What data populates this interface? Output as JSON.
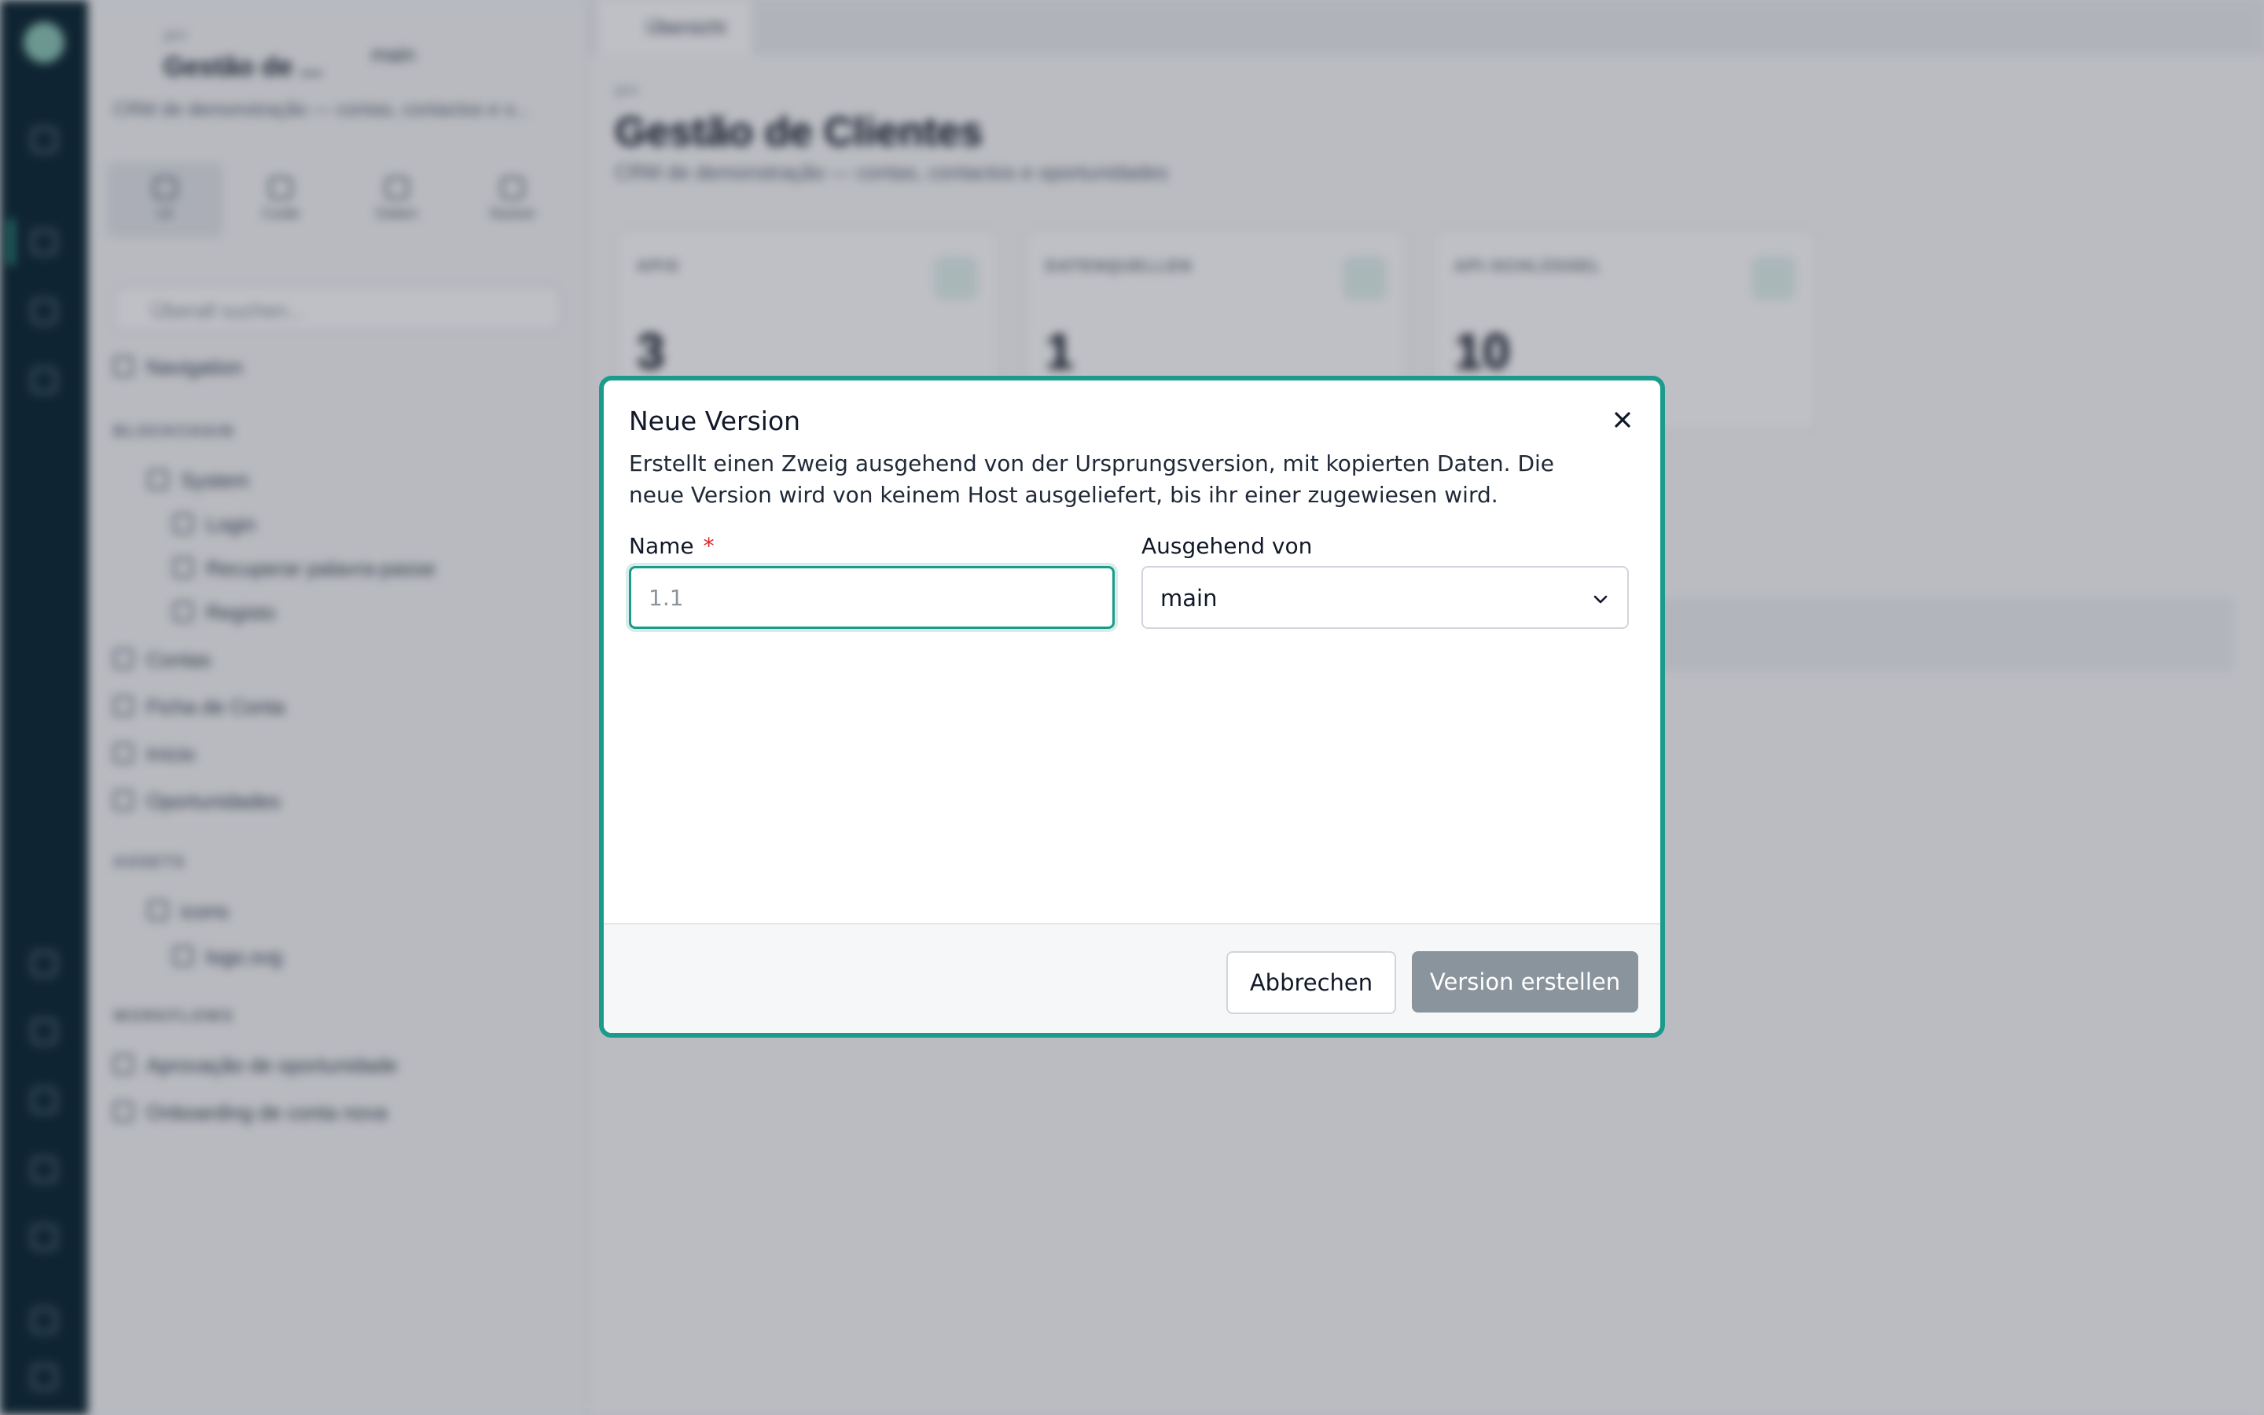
{
  "rail": {
    "icons": [
      "app-logo-icon",
      "grid-icon",
      "users-icon",
      "rocket-icon",
      "chevron-right-icon",
      "rocket-icon",
      "users-icon",
      "key-icon",
      "bolt-icon",
      "box-icon",
      "gear-icon",
      "logout-icon"
    ]
  },
  "sidebar": {
    "project_kicker": "goo",
    "project_title": "Gestão de ...",
    "branch": "main",
    "description": "CRM de demonstração — contas, contactos e o...",
    "tabs": [
      {
        "label": "UI",
        "icon": "layout-icon"
      },
      {
        "label": "Code",
        "icon": "code-icon"
      },
      {
        "label": "Daten",
        "icon": "database-icon"
      },
      {
        "label": "Nutzer",
        "icon": "users-icon"
      }
    ],
    "search_placeholder": "Überall suchen...",
    "navigation_label": "Navigation",
    "sections": {
      "blocks": "BLOCKCHAIN",
      "assets": "ASSETS",
      "workflows": "WORKFLOWS"
    },
    "tree": [
      "System",
      "Login",
      "Recuperar palavra-passe",
      "Registo",
      "Contas",
      "Ficha de Conta",
      "Início",
      "Oportunidades"
    ],
    "assets": [
      "icons",
      "logo.svg"
    ],
    "workflows": [
      "Aprovação de oportunidade",
      "Onboarding de conta nova"
    ]
  },
  "main": {
    "tab_label": "Übersicht",
    "breadcrumb": "goo",
    "title": "Gestão de Clientes",
    "description": "CRM de demonstração — contas, contactos e oportunidades",
    "stats": [
      {
        "label": "APIS",
        "value": "3"
      },
      {
        "label": "DATENQUELLEN",
        "value": "1"
      },
      {
        "label": "API-SCHLÜSSEL",
        "value": "10"
      }
    ]
  },
  "dialog": {
    "title": "Neue Version",
    "description": "Erstellt einen Zweig ausgehend von der Ursprungsversion, mit kopierten Daten. Die neue Version wird von keinem Host ausgeliefert, bis ihr einer zugewiesen wird.",
    "name_label": "Name",
    "required_marker": "*",
    "name_placeholder": "1.1",
    "name_value": "",
    "source_label": "Ausgehend von",
    "source_value": "main",
    "cancel_label": "Abbrechen",
    "create_label": "Version erstellen",
    "accent_color": "#1a9b8c",
    "disabled_button_color": "#8a949c"
  }
}
